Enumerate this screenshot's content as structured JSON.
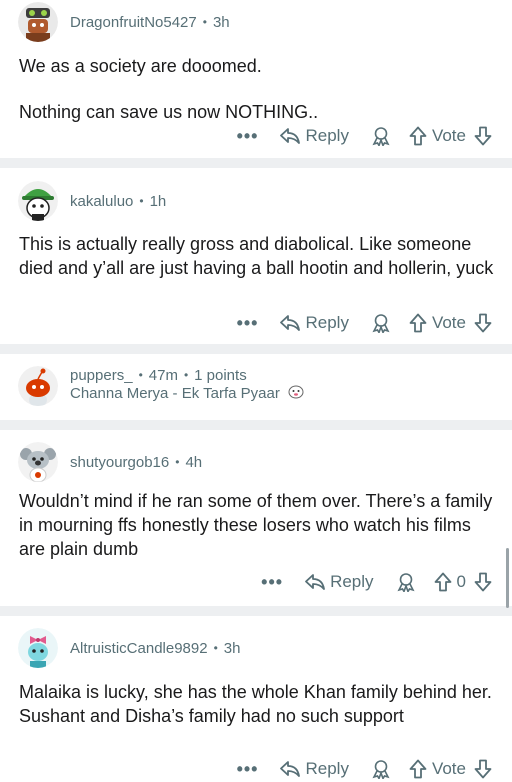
{
  "comments": [
    {
      "username": "DragonfruitNo5427",
      "time": "3h",
      "paragraphs": [
        "We as a society are dooomed.",
        "Nothing can save us now NOTHING.."
      ],
      "more": "•••",
      "reply_label": "Reply",
      "vote_label": "Vote",
      "avatar_icon": "robot-avatar-icon"
    },
    {
      "username": "kakaluluo",
      "time": "1h",
      "paragraphs": [
        "This is actually really gross and diabolical. Like someone died and y’all are just having a ball hootin and hollerin, yuck"
      ],
      "more": "•••",
      "reply_label": "Reply",
      "vote_label": "Vote",
      "avatar_icon": "green-hat-avatar-icon"
    },
    {
      "username": "puppers_",
      "time": "47m",
      "points": "1 points",
      "flair": "Channa Merya - Ek Tarfa Pyaar",
      "collapsed": true,
      "avatar_icon": "snoo-avatar-icon"
    },
    {
      "username": "shutyourgob16",
      "time": "4h",
      "paragraphs": [
        "Wouldn’t mind if he ran some of them over. There’s a family in mourning ffs honestly these losers who watch his films are plain dumb"
      ],
      "more": "•••",
      "reply_label": "Reply",
      "vote_label": "0",
      "avatar_icon": "koala-avatar-icon"
    },
    {
      "username": "AltruisticCandle9892",
      "time": "3h",
      "paragraphs": [
        "Malaika is lucky, she has the whole Khan family behind her. Sushant and Disha’s family had no such support"
      ],
      "more": "•••",
      "reply_label": "Reply",
      "vote_label": "Vote",
      "avatar_icon": "bow-avatar-icon"
    }
  ],
  "colors": {
    "meta": "#576f76",
    "text": "#1a1a1b",
    "separator": "#edeff1"
  }
}
